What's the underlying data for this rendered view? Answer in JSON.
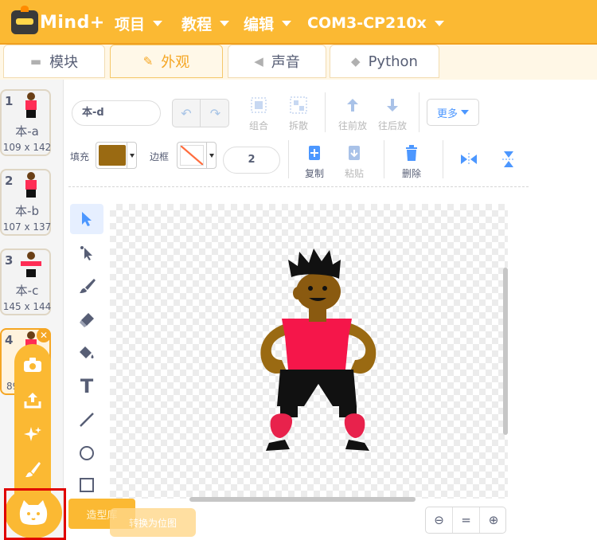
{
  "app": {
    "logo_text": "Mind+"
  },
  "menu": {
    "project": "项目",
    "tutorial": "教程",
    "edit": "编辑",
    "port": "COM3-CP210x"
  },
  "tabs": [
    {
      "label": "模块",
      "icon": "blocks-icon"
    },
    {
      "label": "外观",
      "icon": "brush-icon",
      "active": true
    },
    {
      "label": "声音",
      "icon": "speaker-icon"
    },
    {
      "label": "Python",
      "icon": "python-icon"
    }
  ],
  "costumes": [
    {
      "num": "1",
      "name": "本-a",
      "size": "109 x 142"
    },
    {
      "num": "2",
      "name": "本-b",
      "size": "107 x 137"
    },
    {
      "num": "3",
      "name": "本-c",
      "size": "145 x 144"
    },
    {
      "num": "4",
      "name": "",
      "size": "89"
    }
  ],
  "editor": {
    "costume_name": "本-d",
    "group": "组合",
    "ungroup": "拆散",
    "forward": "往前放",
    "backward": "往后放",
    "more": "更多",
    "fill_label": "填充",
    "stroke_label": "边框",
    "stroke_width": "2",
    "copy": "复制",
    "paste": "粘贴",
    "delete": "删除",
    "fill_color": "#9a6a12"
  },
  "add_menu": {
    "library_label": "造型库",
    "convert_label": "转换为位图"
  }
}
